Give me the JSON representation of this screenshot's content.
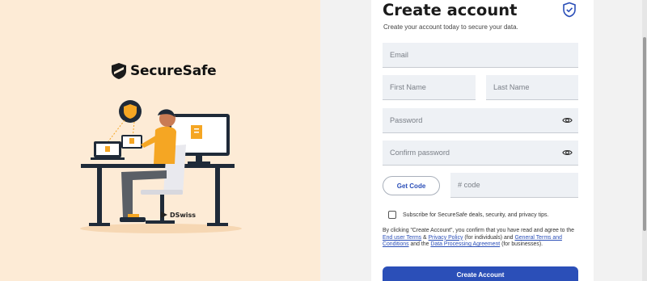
{
  "brand": {
    "name": "SecureSafe",
    "partner": "DSwiss"
  },
  "form": {
    "title": "Create account",
    "subtitle": "Create your account today to secure your data.",
    "email_placeholder": "Email",
    "first_name_placeholder": "First Name",
    "last_name_placeholder": "Last Name",
    "password_placeholder": "Password",
    "confirm_password_placeholder": "Confirm password",
    "get_code_label": "Get Code",
    "code_placeholder": "# code",
    "subscribe_label": "Subscribe for SecureSafe deals, security, and privacy tips.",
    "terms": {
      "part1": "By clicking \"Create Account\", you confirm that you have read and agree to the ",
      "link_end_user": "End user Terms",
      "amp": " & ",
      "link_privacy": "Privacy Policy",
      "part2": " (for individuals) and ",
      "link_general": "General Terms and Conditions",
      "part3": " and the ",
      "link_dpa": "Data Processing Agreement",
      "part4": " (for businesses)."
    },
    "create_button_label": "Create Account"
  },
  "colors": {
    "accent": "#2b4fb8",
    "left_bg": "#fdebd6",
    "orange": "#f5a623"
  }
}
